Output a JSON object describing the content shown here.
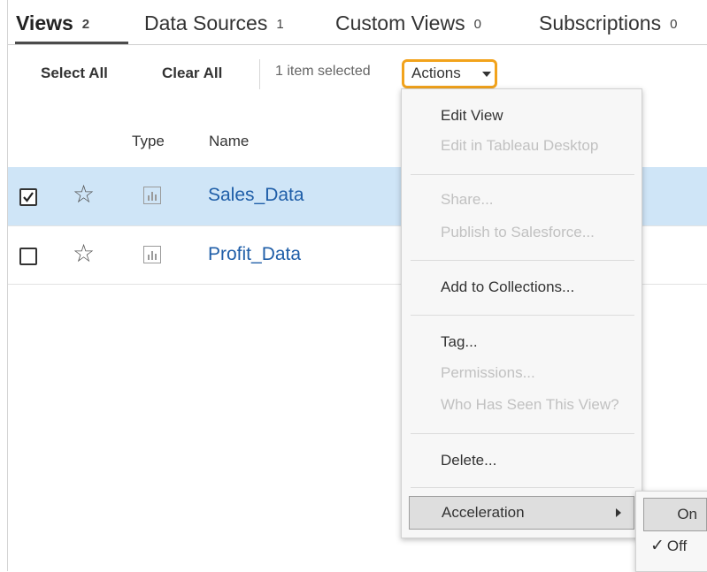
{
  "tabs": [
    {
      "label": "Views",
      "count": "2"
    },
    {
      "label": "Data Sources",
      "count": "1"
    },
    {
      "label": "Custom Views",
      "count": "0"
    },
    {
      "label": "Subscriptions",
      "count": "0"
    }
  ],
  "toolbar": {
    "select_all": "Select All",
    "clear_all": "Clear All",
    "selection_status": "1 item selected",
    "actions_label": "Actions"
  },
  "columns": {
    "type": "Type",
    "name": "Name"
  },
  "rows": [
    {
      "name": "Sales_Data",
      "checked": true,
      "favorite": false,
      "type_icon": "view-chart-icon"
    },
    {
      "name": "Profit_Data",
      "checked": false,
      "favorite": false,
      "type_icon": "view-chart-icon"
    }
  ],
  "actions_menu": {
    "edit_view": "Edit View",
    "edit_in_desktop": "Edit in Tableau Desktop",
    "share": "Share...",
    "publish_salesforce": "Publish to Salesforce...",
    "add_collections": "Add to Collections...",
    "tag": "Tag...",
    "permissions": "Permissions...",
    "who_has_seen": "Who Has Seen This View?",
    "delete": "Delete...",
    "acceleration": "Acceleration"
  },
  "acceleration_submenu": {
    "on": "On",
    "off": "Off",
    "checked": "✓"
  },
  "colors": {
    "accent_highlight": "#f2a31c",
    "selected_row": "#cfe5f7",
    "link": "#1f5ea8"
  }
}
